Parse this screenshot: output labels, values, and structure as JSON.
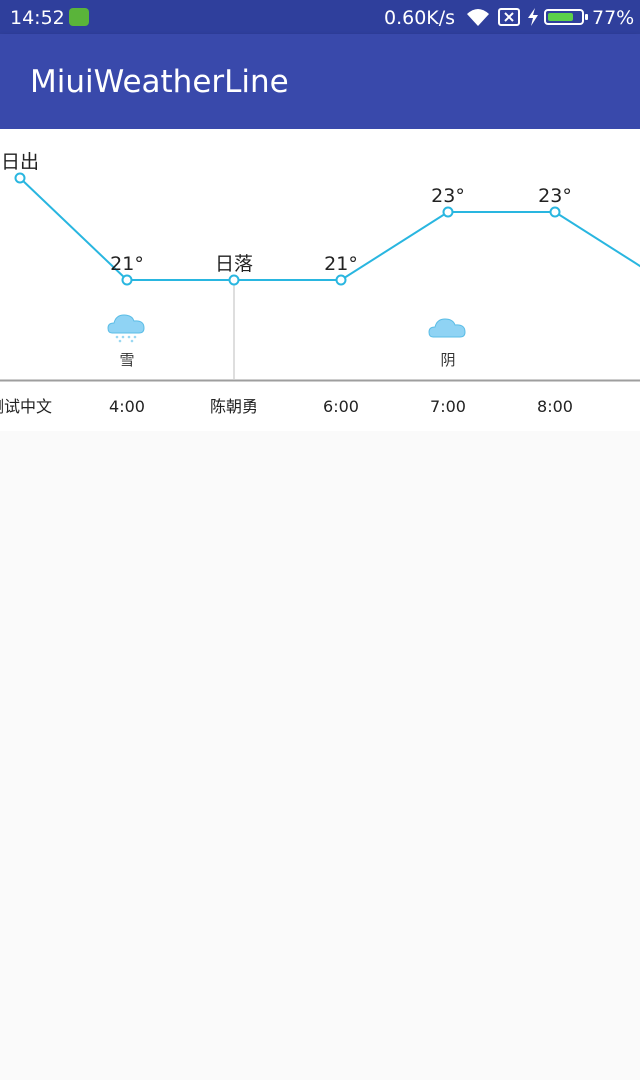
{
  "status_bar": {
    "time": "14:52",
    "net_speed": "0.60K/s",
    "battery_percent": "77%",
    "battery_level": 0.77
  },
  "app_bar": {
    "title": "MiuiWeatherLine"
  },
  "colors": {
    "status_bar": "#2f3f9c",
    "app_bar": "#3949ab",
    "line": "#29b6e0",
    "cloud": "#8fd3f4",
    "baseline": "#9e9e9e"
  },
  "chart_data": {
    "type": "line",
    "points": [
      {
        "label": "日出",
        "time": "测试中文",
        "value": 24
      },
      {
        "label": "21°",
        "time": "4:00",
        "value": 21,
        "weather": "雪",
        "icon": "snow-cloud-icon"
      },
      {
        "label": "日落",
        "time": "陈朝勇",
        "value": 21
      },
      {
        "label": "21°",
        "time": "6:00",
        "value": 21
      },
      {
        "label": "23°",
        "time": "7:00",
        "value": 23,
        "weather": "阴",
        "icon": "cloudy-icon"
      },
      {
        "label": "23°",
        "time": "8:00",
        "value": 23
      },
      {
        "label": "",
        "time": "",
        "value": 21
      }
    ],
    "x_tick_labels": [
      "测试中文",
      "4:00",
      "陈朝勇",
      "6:00",
      "7:00",
      "8:00"
    ],
    "grid": false
  }
}
